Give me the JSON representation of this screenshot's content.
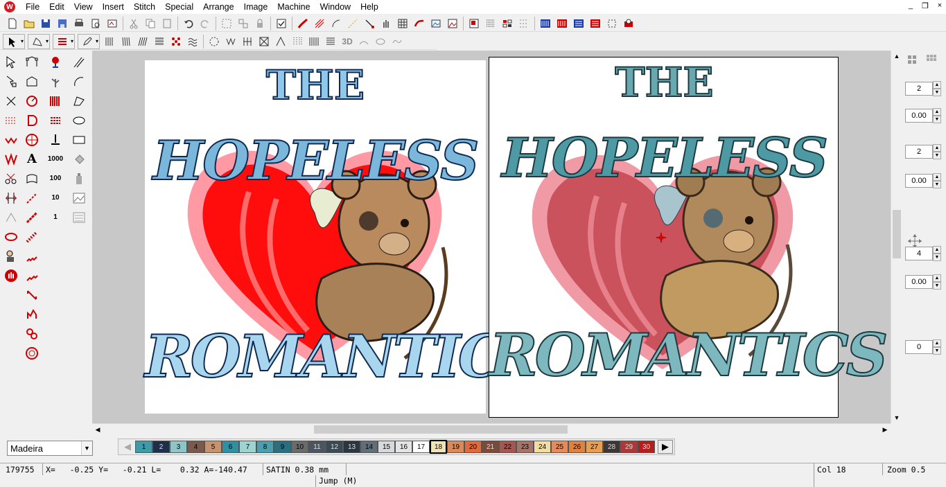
{
  "menu": {
    "items": [
      "File",
      "Edit",
      "View",
      "Insert",
      "Stitch",
      "Special",
      "Arrange",
      "Image",
      "Machine",
      "Window",
      "Help"
    ],
    "window_controls": [
      "_",
      "❐",
      "×"
    ]
  },
  "design": {
    "left_title_lines": [
      "THE",
      "HOPELESS",
      "ROMANTICS"
    ],
    "right_title_lines": [
      "THE",
      "HOPELESS",
      "ROMANTICS"
    ]
  },
  "left_tools": {
    "digits_1000": "1000",
    "digits_100": "100",
    "digits_10": "10",
    "digits_1": "1",
    "text_tool": "A"
  },
  "toolbar2": {
    "label_3d": "3D"
  },
  "right_panel": {
    "spin1": "2",
    "spin2": "0.00",
    "spin3": "2",
    "spin4": "0.00",
    "spin5": "4",
    "spin6": "0.00",
    "spin7": "0"
  },
  "thread_chart": {
    "selected": "Madeira"
  },
  "palette": {
    "colors": [
      {
        "n": "1",
        "c": "#3d9aa6"
      },
      {
        "n": "2",
        "c": "#1f2f4a"
      },
      {
        "n": "3",
        "c": "#8fc5c9"
      },
      {
        "n": "4",
        "c": "#7a5a4a"
      },
      {
        "n": "5",
        "c": "#c49470"
      },
      {
        "n": "6",
        "c": "#2f8fa3"
      },
      {
        "n": "7",
        "c": "#9fd3d0"
      },
      {
        "n": "8",
        "c": "#4a9fae"
      },
      {
        "n": "9",
        "c": "#2a6f80"
      },
      {
        "n": "10",
        "c": "#6a6a6a"
      },
      {
        "n": "11",
        "c": "#4a5560"
      },
      {
        "n": "12",
        "c": "#3a4a55"
      },
      {
        "n": "13",
        "c": "#2a3540"
      },
      {
        "n": "14",
        "c": "#5f6e78"
      },
      {
        "n": "15",
        "c": "#d6dadc"
      },
      {
        "n": "16",
        "c": "#e4e4e4"
      },
      {
        "n": "17",
        "c": "#ffffff"
      },
      {
        "n": "18",
        "c": "#f0e2b8"
      },
      {
        "n": "19",
        "c": "#d98a5a"
      },
      {
        "n": "20",
        "c": "#e06a3a"
      },
      {
        "n": "21",
        "c": "#7a4a3a"
      },
      {
        "n": "22",
        "c": "#a5574f"
      },
      {
        "n": "23",
        "c": "#a2746a"
      },
      {
        "n": "24",
        "c": "#f3dca0"
      },
      {
        "n": "25",
        "c": "#e58c5f"
      },
      {
        "n": "26",
        "c": "#e0823f"
      },
      {
        "n": "27",
        "c": "#e6a055"
      },
      {
        "n": "28",
        "c": "#3d3635"
      },
      {
        "n": "29",
        "c": "#a83a3a"
      },
      {
        "n": "30",
        "c": "#b31e1e"
      }
    ],
    "active": "18"
  },
  "status": {
    "stitch_count": "179755",
    "coords": "X=   -0.25 Y=   -0.21 L=    0.32 A=-140.47",
    "stitch_type": "SATIN  0.38 mm",
    "color": "Col 18",
    "zoom": "Zoom 0.5",
    "hint": "Jump (M)"
  }
}
